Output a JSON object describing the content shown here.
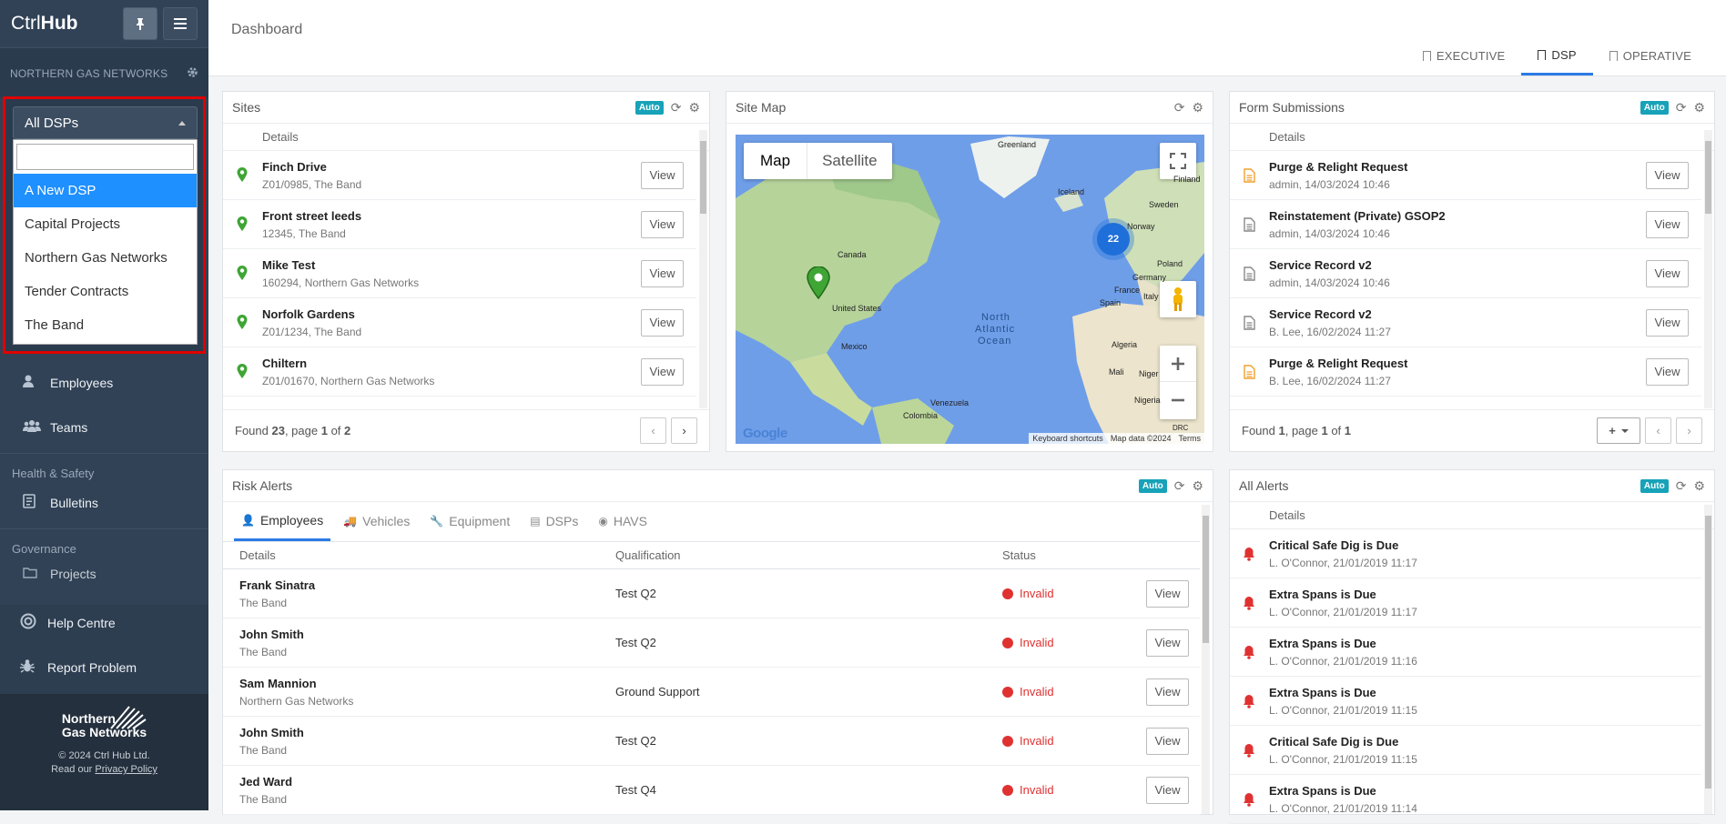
{
  "app": {
    "logo_light": "Ctrl",
    "logo_bold": "Hub"
  },
  "sidebar": {
    "org_name": "NORTHERN GAS NETWORKS",
    "dsp_select": {
      "value": "All DSPs",
      "search_value": "",
      "options": [
        "A New DSP",
        "Capital Projects",
        "Northern Gas Networks",
        "Tender Contracts",
        "The Band"
      ],
      "highlighted": "A New DSP"
    },
    "items": [
      {
        "label": "Employees",
        "icon": "user-icon"
      },
      {
        "label": "Teams",
        "icon": "users-icon"
      }
    ],
    "section_health": "Health & Safety",
    "bulletins": "Bulletins",
    "section_governance": "Governance",
    "projects": "Projects",
    "help": "Help Centre",
    "report": "Report Problem",
    "footer": {
      "logo_line1": "Northern",
      "logo_line2": "Gas Networks",
      "copyright": "© 2024 Ctrl Hub Ltd.",
      "read": "Read our",
      "privacy": "Privacy Policy"
    }
  },
  "header": {
    "breadcrumb": "Dashboard",
    "tabs": [
      "EXECUTIVE",
      "DSP",
      "OPERATIVE"
    ],
    "active_tab": "DSP"
  },
  "auto_label": "Auto",
  "view_label": "View",
  "details_label": "Details",
  "sites": {
    "title": "Sites",
    "rows": [
      {
        "name": "Finch Drive",
        "sub": "Z01/0985, The Band"
      },
      {
        "name": "Front street leeds",
        "sub": "12345, The Band"
      },
      {
        "name": "Mike Test",
        "sub": "160294, Northern Gas Networks"
      },
      {
        "name": "Norfolk Gardens",
        "sub": "Z01/1234, The Band"
      },
      {
        "name": "Chiltern",
        "sub": "Z01/01670, Northern Gas Networks"
      }
    ],
    "found_pre": "Found ",
    "found": "23",
    "page_pre": ", page ",
    "page": "1",
    "of_pre": " of ",
    "pages": "2"
  },
  "sitemap": {
    "title": "Site Map",
    "btn_map": "Map",
    "btn_sat": "Satellite",
    "cluster": "22",
    "labels": {
      "greenland": "Greenland",
      "iceland": "Iceland",
      "finland": "Finland",
      "sweden": "Sweden",
      "norway": "Norway",
      "canada": "Canada",
      "poland": "Poland",
      "germany": "Germany",
      "france": "France",
      "spain": "Spain",
      "italy": "Italy",
      "united_states": "United States",
      "mexico": "Mexico",
      "ocean1": "North",
      "ocean2": "Atlantic",
      "ocean3": "Ocean",
      "algeria": "Algeria",
      "mali": "Mali",
      "niger": "Niger",
      "nigeria": "Nigeria",
      "drc": "DRC",
      "venezuela": "Venezuela",
      "colombia": "Colombia"
    },
    "google": "Google",
    "kb": "Keyboard shortcuts",
    "mapdata": "Map data ©2024",
    "terms": "Terms"
  },
  "forms": {
    "title": "Form Submissions",
    "rows": [
      {
        "name": "Purge & Relight Request",
        "sub": "admin, 14/03/2024 10:46",
        "color": "#f0a030"
      },
      {
        "name": "Reinstatement (Private) GSOP2",
        "sub": "admin, 14/03/2024 10:46",
        "color": "#888888"
      },
      {
        "name": "Service Record v2",
        "sub": "admin, 14/03/2024 10:46",
        "color": "#888888"
      },
      {
        "name": "Service Record v2",
        "sub": "B. Lee, 16/02/2024 11:27",
        "color": "#888888"
      },
      {
        "name": "Purge & Relight Request",
        "sub": "B. Lee, 16/02/2024 11:27",
        "color": "#f0a030"
      }
    ],
    "found_pre": "Found ",
    "found": "1",
    "page_pre": ", page ",
    "page": "1",
    "of_pre": " of ",
    "pages": "1"
  },
  "risk": {
    "title": "Risk Alerts",
    "tabs": [
      "Employees",
      "Vehicles",
      "Equipment",
      "DSPs",
      "HAVS"
    ],
    "cols": [
      "Details",
      "Qualification",
      "Status"
    ],
    "rows": [
      {
        "name": "Frank Sinatra",
        "org": "The Band",
        "qual": "Test Q2",
        "status": "Invalid"
      },
      {
        "name": "John Smith",
        "org": "The Band",
        "qual": "Test Q2",
        "status": "Invalid"
      },
      {
        "name": "Sam Mannion",
        "org": "Northern Gas Networks",
        "qual": "Ground Support",
        "status": "Invalid"
      },
      {
        "name": "John Smith",
        "org": "The Band",
        "qual": "Test Q2",
        "status": "Invalid"
      },
      {
        "name": "Jed Ward",
        "org": "The Band",
        "qual": "Test Q4",
        "status": "Invalid"
      }
    ]
  },
  "alerts": {
    "title": "All Alerts",
    "rows": [
      {
        "name": "Critical Safe Dig is Due",
        "sub": "L. O'Connor, 21/01/2019 11:17"
      },
      {
        "name": "Extra Spans is Due",
        "sub": "L. O'Connor, 21/01/2019 11:17"
      },
      {
        "name": "Extra Spans is Due",
        "sub": "L. O'Connor, 21/01/2019 11:16"
      },
      {
        "name": "Extra Spans is Due",
        "sub": "L. O'Connor, 21/01/2019 11:15"
      },
      {
        "name": "Critical Safe Dig is Due",
        "sub": "L. O'Connor, 21/01/2019 11:15"
      },
      {
        "name": "Extra Spans is Due",
        "sub": "L. O'Connor, 21/01/2019 11:14"
      }
    ]
  },
  "colors": {
    "sidebar": "#314256",
    "accent": "#2c7be5",
    "auto_badge": "#17a2b8",
    "pin_green": "#3fa535",
    "alert_red": "#e03131",
    "highlight": "#1e90ff"
  }
}
